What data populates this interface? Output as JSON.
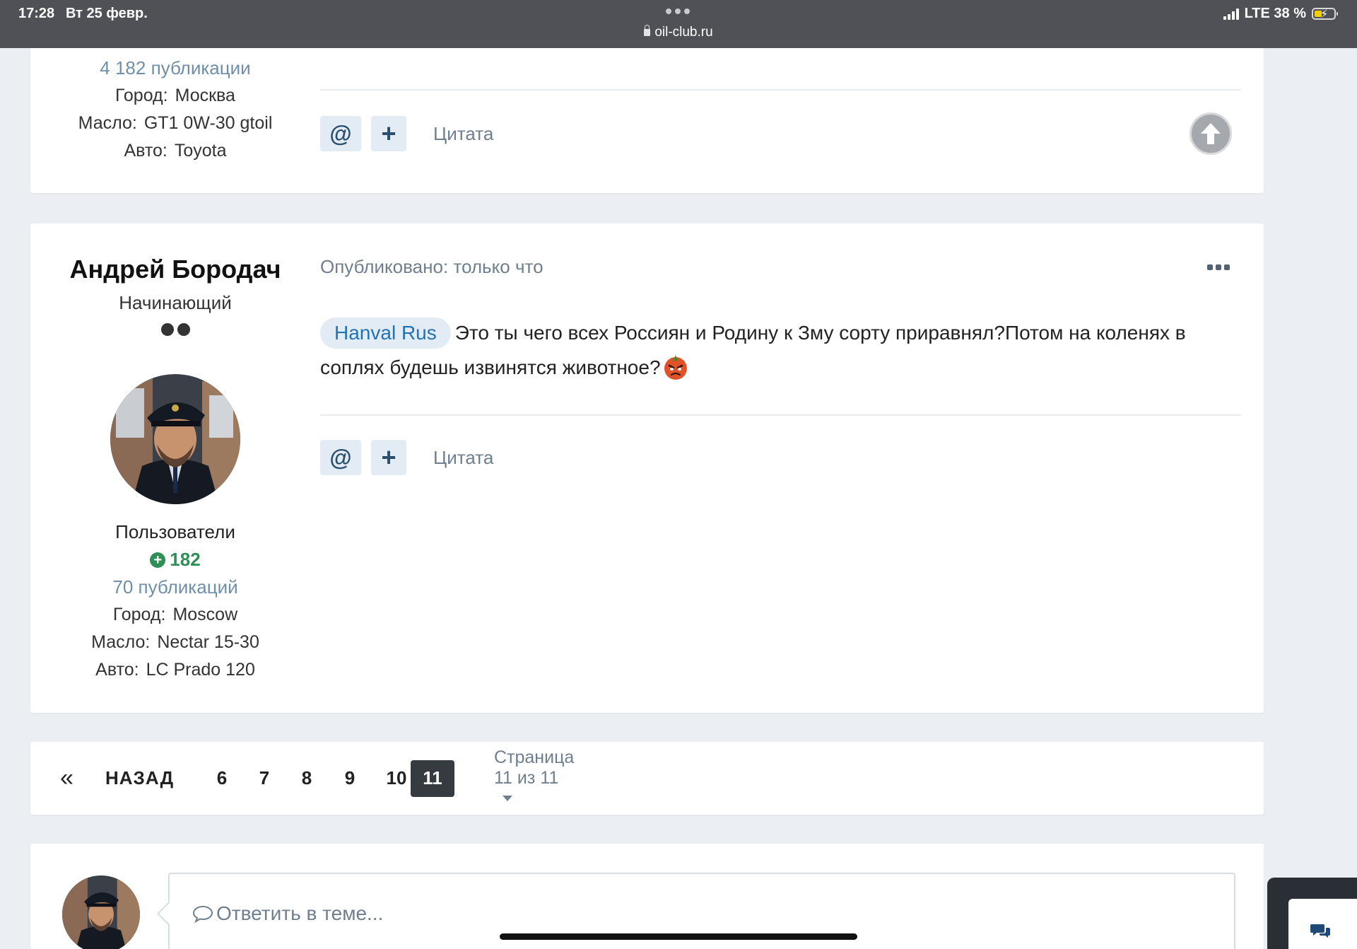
{
  "status_bar": {
    "time": "17:28",
    "date": "Вт 25 февр.",
    "url": "oil-club.ru",
    "network": "LTE 38 %"
  },
  "prev_post": {
    "pubs": "4 182 публикации",
    "fields": [
      {
        "label": "Город:",
        "value": "Москва"
      },
      {
        "label": "Масло:",
        "value": "GT1 0W-30 gtoil"
      },
      {
        "label": "Авто:",
        "value": "Toyota"
      }
    ],
    "quote_label": "Цитата"
  },
  "post": {
    "author": "Андрей Бородач",
    "rank": "Начинающий",
    "group": "Пользователи",
    "reputation": "182",
    "pubs": "70 публикаций",
    "fields": [
      {
        "label": "Город:",
        "value": "Moscow"
      },
      {
        "label": "Масло:",
        "value": "Nectar 15-30"
      },
      {
        "label": "Авто:",
        "value": "LC Prado 120"
      }
    ],
    "posted": "Опубликовано: только что",
    "mention": "Hanval Rus",
    "text": "Это ты чего всех Россиян и Родину к Зму сорту приравнял?Потом на коленях в соплях будешь извинятся животное?",
    "quote_label": "Цитата"
  },
  "pagination": {
    "first": "«",
    "back": "НАЗАД",
    "pages": [
      "6",
      "7",
      "8",
      "9",
      "10"
    ],
    "current": "11",
    "jump": "Страница 11 из 11"
  },
  "reply": {
    "placeholder": "Ответить в теме..."
  },
  "colors": {
    "accent": "#2273b5",
    "reputation": "#2e8f57",
    "muted": "#6f7f8f"
  }
}
